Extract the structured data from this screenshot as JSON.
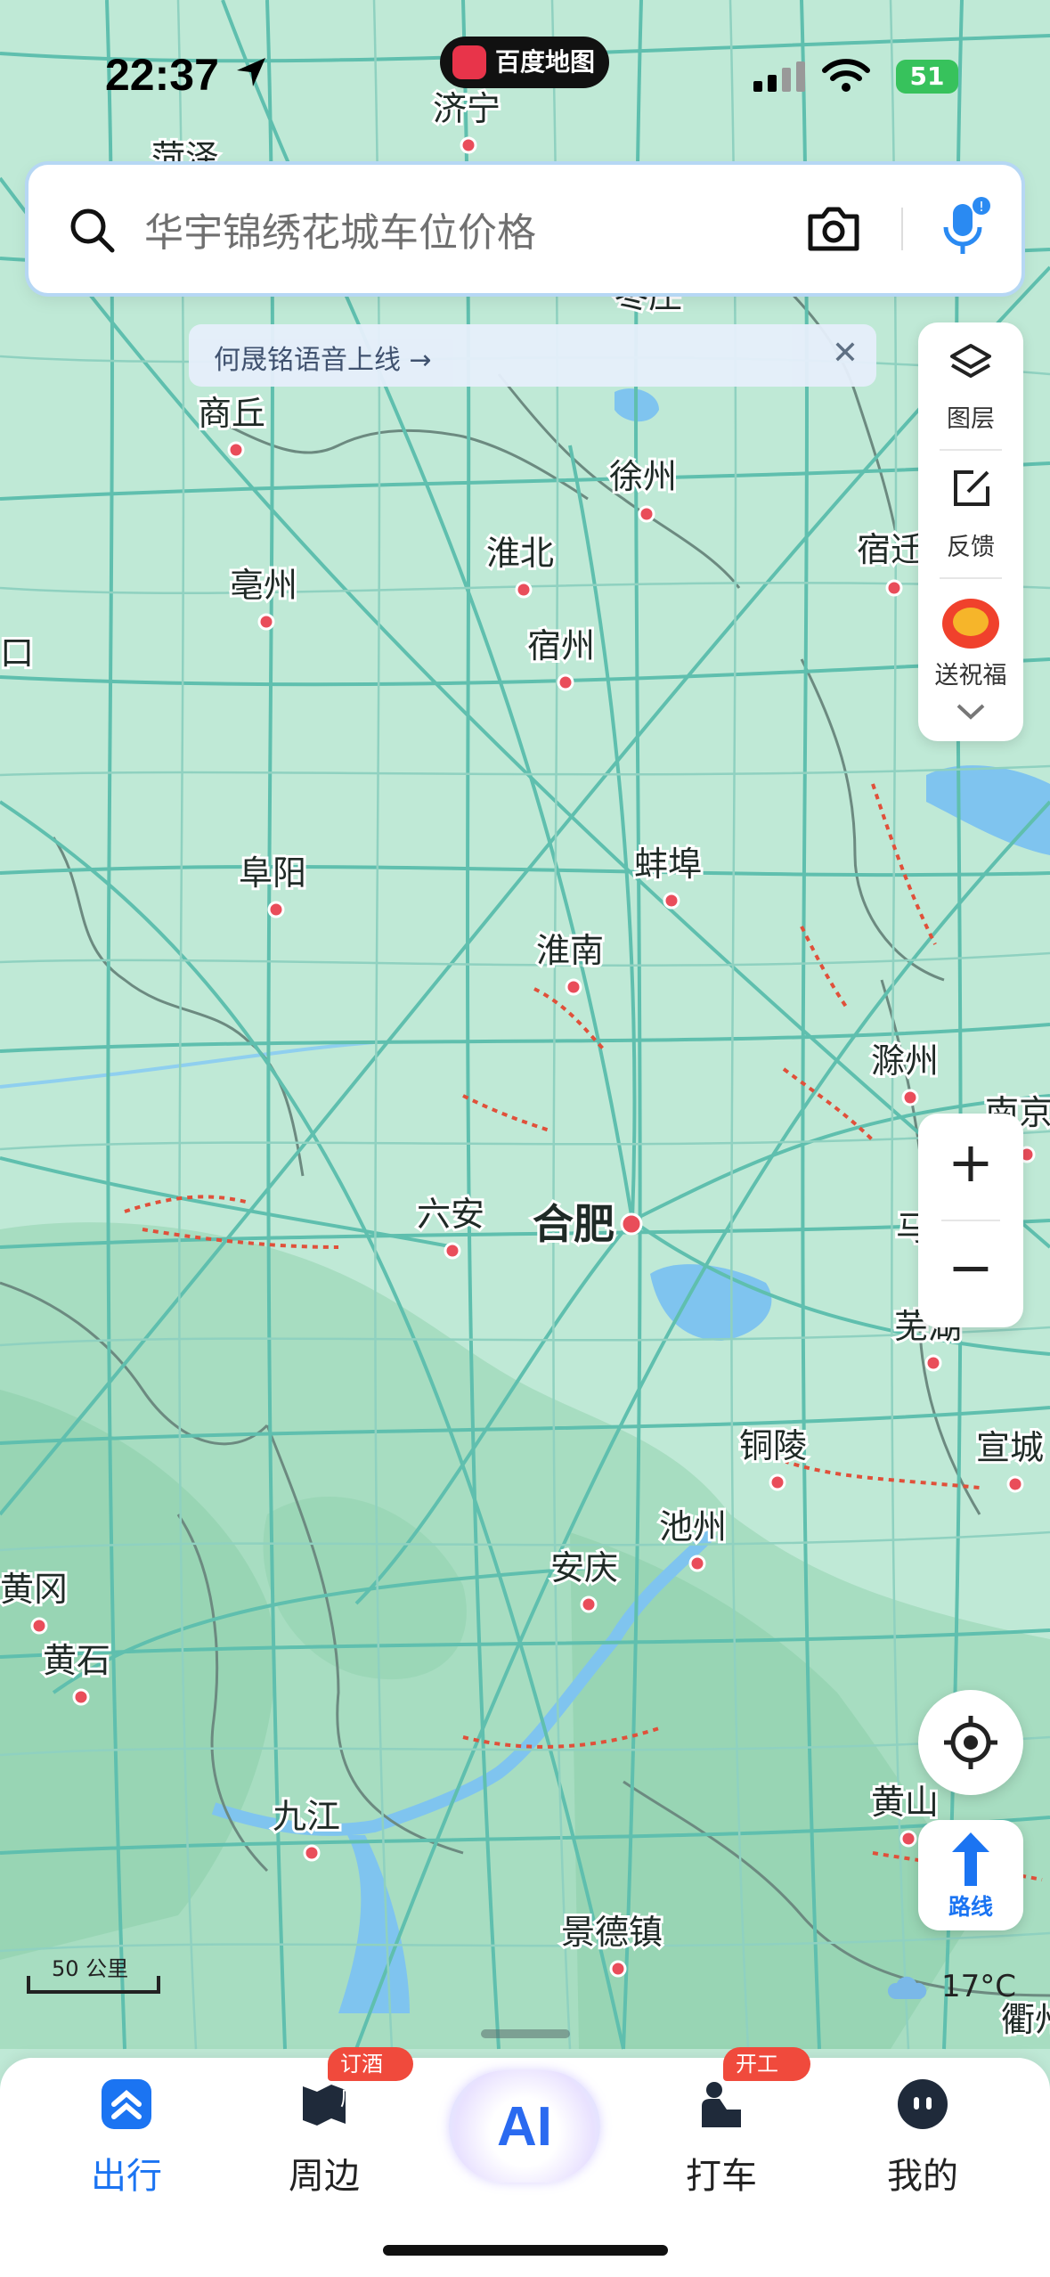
{
  "status_bar": {
    "time": "22:37",
    "app_pill": "百度地图",
    "battery": "51"
  },
  "search": {
    "placeholder": "华宇锦绣花城车位价格"
  },
  "notice": {
    "text": "何晟铭语音上线 →",
    "close": "✕"
  },
  "side_panel": {
    "layers": "图层",
    "feedback": "反馈",
    "blessing": "送祝福"
  },
  "zoom": {
    "in": "+",
    "out": "−"
  },
  "route_button": {
    "label": "路线"
  },
  "scale_bar": {
    "label": "50 公里"
  },
  "weather": {
    "temp": "17°C"
  },
  "cities": [
    {
      "name": "济宁",
      "bold": false
    },
    {
      "name": "菏泽",
      "bold": false
    },
    {
      "name": "枣庄",
      "bold": false
    },
    {
      "name": "商丘",
      "bold": false
    },
    {
      "name": "徐州",
      "bold": false
    },
    {
      "name": "淮北",
      "bold": false
    },
    {
      "name": "宿迁",
      "bold": false
    },
    {
      "name": "亳州",
      "bold": false
    },
    {
      "name": "宿州",
      "bold": false
    },
    {
      "name": "口",
      "bold": false
    },
    {
      "name": "阜阳",
      "bold": false
    },
    {
      "name": "蚌埠",
      "bold": false
    },
    {
      "name": "淮南",
      "bold": false
    },
    {
      "name": "滁州",
      "bold": false
    },
    {
      "name": "南京",
      "bold": false
    },
    {
      "name": "六安",
      "bold": false
    },
    {
      "name": "合肥",
      "bold": true
    },
    {
      "name": "马",
      "bold": false
    },
    {
      "name": "芜湖",
      "bold": false
    },
    {
      "name": "铜陵",
      "bold": false
    },
    {
      "name": "宣城",
      "bold": false
    },
    {
      "name": "池州",
      "bold": false
    },
    {
      "name": "安庆",
      "bold": false
    },
    {
      "name": "黄冈",
      "bold": false
    },
    {
      "name": "黄石",
      "bold": false
    },
    {
      "name": "黄山",
      "bold": false
    },
    {
      "name": "九江",
      "bold": false
    },
    {
      "name": "景德镇",
      "bold": false
    },
    {
      "name": "衢州",
      "bold": false
    }
  ],
  "tabs": [
    {
      "label": "出行",
      "active": true,
      "badge": ""
    },
    {
      "label": "周边",
      "active": false,
      "badge": "订酒店"
    },
    {
      "label": "AI",
      "active": false,
      "badge": ""
    },
    {
      "label": "打车",
      "active": false,
      "badge": "开工券"
    },
    {
      "label": "我的",
      "active": false,
      "badge": ""
    }
  ],
  "colors": {
    "map_bg": "#bfe9d6",
    "road": "#5fbfae",
    "accent": "#1b74f2",
    "badge": "#f04a3c"
  }
}
